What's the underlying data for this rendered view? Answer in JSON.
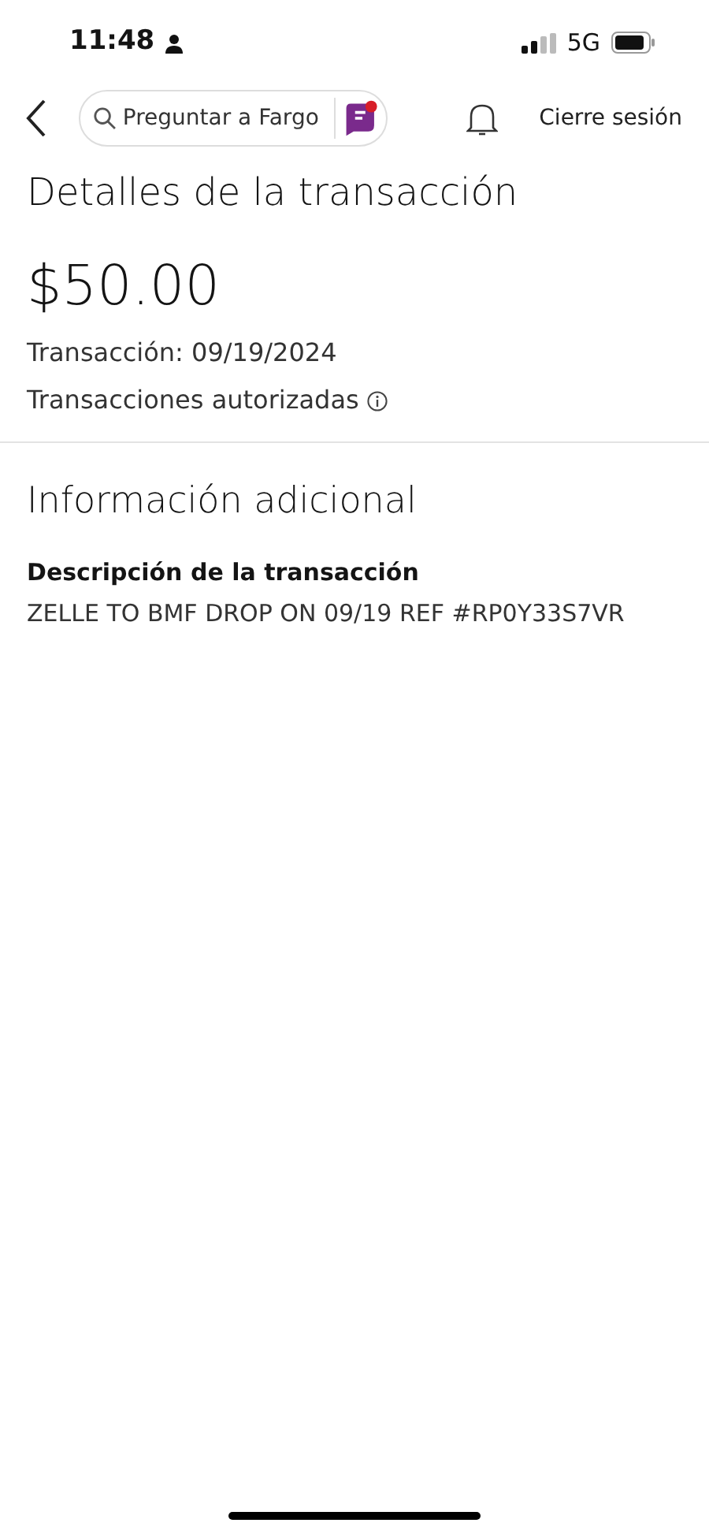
{
  "status_bar": {
    "time": "11:48",
    "network": "5G"
  },
  "nav": {
    "search": {
      "placeholder": "Preguntar a Fargo"
    },
    "logout": "Cierre sesión"
  },
  "title": "Detalles de la transacción",
  "amount": "$50.00",
  "date": "Transacción: 09/19/2024",
  "status": "Transacciones autorizadas",
  "section": {
    "heading": "Información adicional",
    "label": "Descripción de la transacción",
    "value": "ZELLE TO BMF DROP ON 09/19 REF #RP0Y33S7VR"
  }
}
